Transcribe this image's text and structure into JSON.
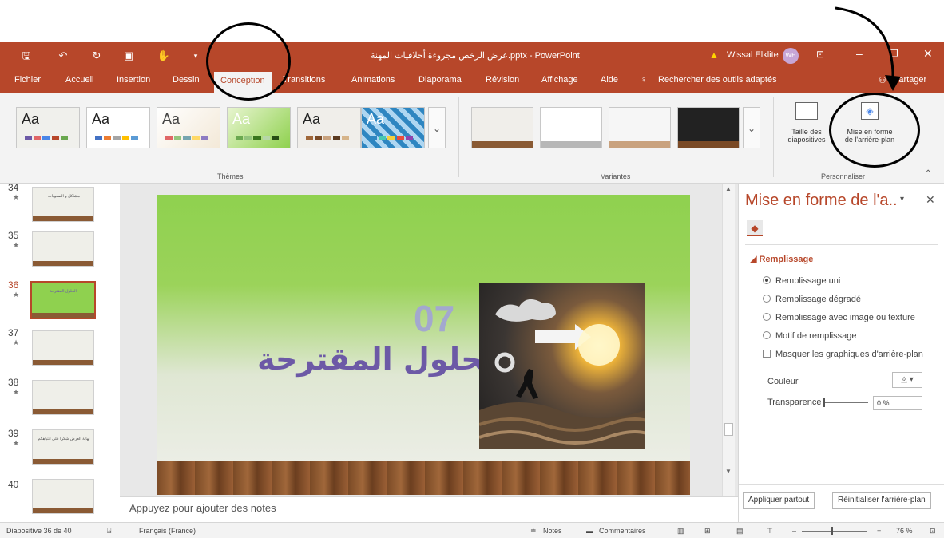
{
  "window": {
    "title": "عرض الرخص مجروءة أحلاقيات المهنة.pptx - PowerPoint",
    "user_name": "Wissal Elklite",
    "user_initials": "WE",
    "share_label": "Partager"
  },
  "tabs": [
    {
      "label": "Fichier"
    },
    {
      "label": "Accueil"
    },
    {
      "label": "Insertion"
    },
    {
      "label": "Dessin"
    },
    {
      "label": "Conception",
      "active": true
    },
    {
      "label": "Transitions"
    },
    {
      "label": "Animations"
    },
    {
      "label": "Diaporama"
    },
    {
      "label": "Révision"
    },
    {
      "label": "Affichage"
    },
    {
      "label": "Aide"
    }
  ],
  "search_tools_label": "Rechercher des outils adaptés",
  "ribbon": {
    "themes_group_label": "Thèmes",
    "theme_labels": [
      "Aa",
      "Aa",
      "Aa",
      "Aa",
      "Aa",
      "Aa"
    ],
    "variants_group_label": "Variantes",
    "customize_group_label": "Personnaliser",
    "slide_size_label_1": "Taille des",
    "slide_size_label_2": "diapositives",
    "format_bg_label_1": "Mise en forme",
    "format_bg_label_2": "de l'arrière-plan"
  },
  "thumbnails": [
    {
      "number": "34",
      "text": "مشاكل و الصعوبات",
      "selected": false
    },
    {
      "number": "35",
      "text": "",
      "selected": false
    },
    {
      "number": "36",
      "text": "الحلول المقترحة",
      "selected": true
    },
    {
      "number": "37",
      "text": "",
      "selected": false
    },
    {
      "number": "38",
      "text": "",
      "selected": false
    },
    {
      "number": "39",
      "text": "نهاية العرض شكرا على انتباهكم",
      "selected": false
    },
    {
      "number": "40",
      "text": "",
      "selected": false
    }
  ],
  "slide": {
    "number": "07",
    "title": "الحلول المقترحة"
  },
  "notes_placeholder": "Appuyez pour ajouter des notes",
  "pane": {
    "title": "Mise en forme de l'a..",
    "section": "Remplissage",
    "options": [
      {
        "label": "Remplissage uni",
        "selected": true
      },
      {
        "label": "Remplissage dégradé",
        "selected": false
      },
      {
        "label": "Remplissage avec image ou texture",
        "selected": false
      },
      {
        "label": "Motif de remplissage",
        "selected": false
      }
    ],
    "hide_bg_graphics": "Masquer les graphiques d'arrière-plan",
    "color_label": "Couleur",
    "transparency_label": "Transparence",
    "transparency_value": "0 %",
    "apply_all": "Appliquer partout",
    "reset_bg": "Réinitialiser l'arrière-plan"
  },
  "status": {
    "slide_info": "Diapositive 36 de 40",
    "language": "Français (France)",
    "notes": "Notes",
    "comments": "Commentaires",
    "zoom": "76 %"
  },
  "colors": {
    "accent": "#b7472a",
    "slide_title": "#6c59a6"
  }
}
